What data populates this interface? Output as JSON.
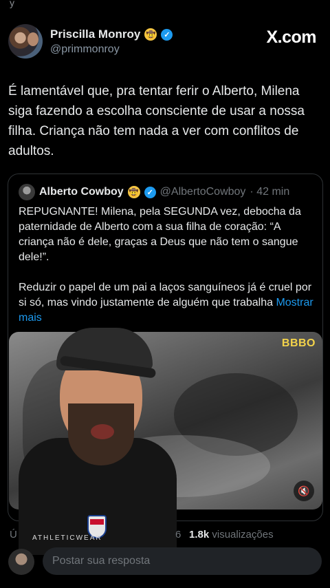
{
  "top_fragment": "y",
  "header": {
    "display_name": "Priscilla Monroy",
    "emoji": "🤠",
    "handle": "@primmonroy",
    "brand": "X.com"
  },
  "post": {
    "text": "É lamentável que, pra tentar ferir o Alberto, Milena siga fazendo a escolha consciente de usar a nossa filha. Criança não tem nada a ver com conflitos de adultos."
  },
  "quote": {
    "display_name": "Alberto Cowboy",
    "emoji": "🤠",
    "handle": "@AlbertoCowboy",
    "time": "· 42 min",
    "paragraph1": "REPUGNANTE! Milena, pela SEGUNDA vez, debocha da paternidade de Alberto com a sua filha de coração: “A criança não é dele, graças a Deus que não tem o sangue dele!”.",
    "paragraph2": "Reduzir o papel de um pai a laços sanguíneos já é cruel por si só, mas vindo justamente de alguém que trabalha",
    "show_more": "Mostrar mais",
    "media_watermark": "BBBO",
    "mute_icon": "volume-mute-icon"
  },
  "overlay_shirt_text": "ATHLETICWEAR",
  "stats": {
    "left_fragment": "Ú",
    "mid_fragment": "6",
    "views_count": "1.8k",
    "views_label": "visualizações"
  },
  "reply": {
    "placeholder": "Postar sua resposta"
  },
  "colors": {
    "background": "#000000",
    "text": "#e7e9ea",
    "muted": "#71767b",
    "link": "#1d9bf0",
    "verified": "#1d9bf0",
    "watermark": "#f3d34a"
  }
}
